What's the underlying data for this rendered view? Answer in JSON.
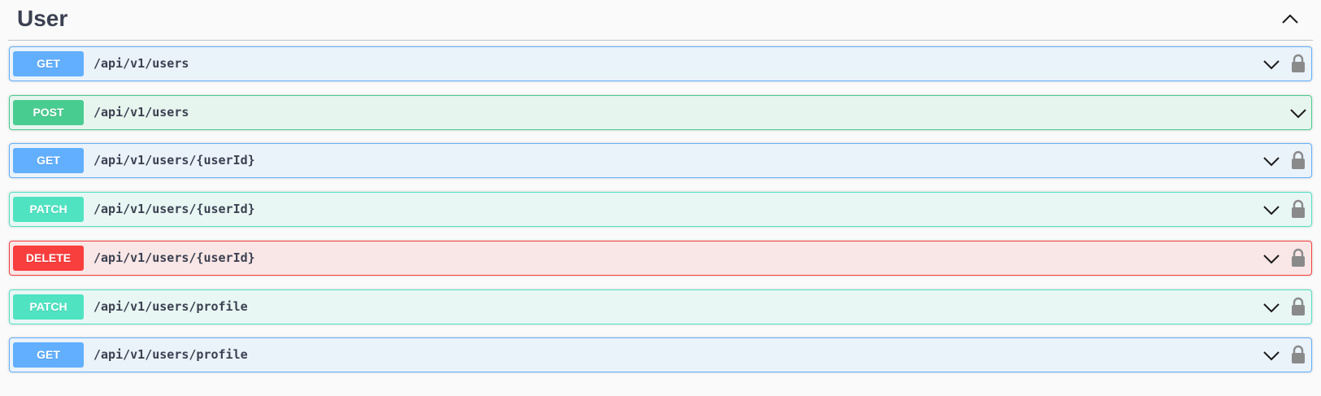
{
  "section": {
    "title": "User",
    "collapse_icon": "chevron-up-icon"
  },
  "colors": {
    "get": "#61affe",
    "post": "#49cc90",
    "patch": "#50e3c2",
    "delete": "#f93e3e",
    "text": "#3b4151",
    "lock": "#8a8a8a"
  },
  "operations": [
    {
      "method": "GET",
      "path": "/api/v1/users",
      "locked": true
    },
    {
      "method": "POST",
      "path": "/api/v1/users",
      "locked": false
    },
    {
      "method": "GET",
      "path": "/api/v1/users/{userId}",
      "locked": true
    },
    {
      "method": "PATCH",
      "path": "/api/v1/users/{userId}",
      "locked": true
    },
    {
      "method": "DELETE",
      "path": "/api/v1/users/{userId}",
      "locked": true
    },
    {
      "method": "PATCH",
      "path": "/api/v1/users/profile",
      "locked": true
    },
    {
      "method": "GET",
      "path": "/api/v1/users/profile",
      "locked": true
    }
  ],
  "icons": {
    "expand": "chevron-down-icon",
    "auth": "lock-icon"
  }
}
